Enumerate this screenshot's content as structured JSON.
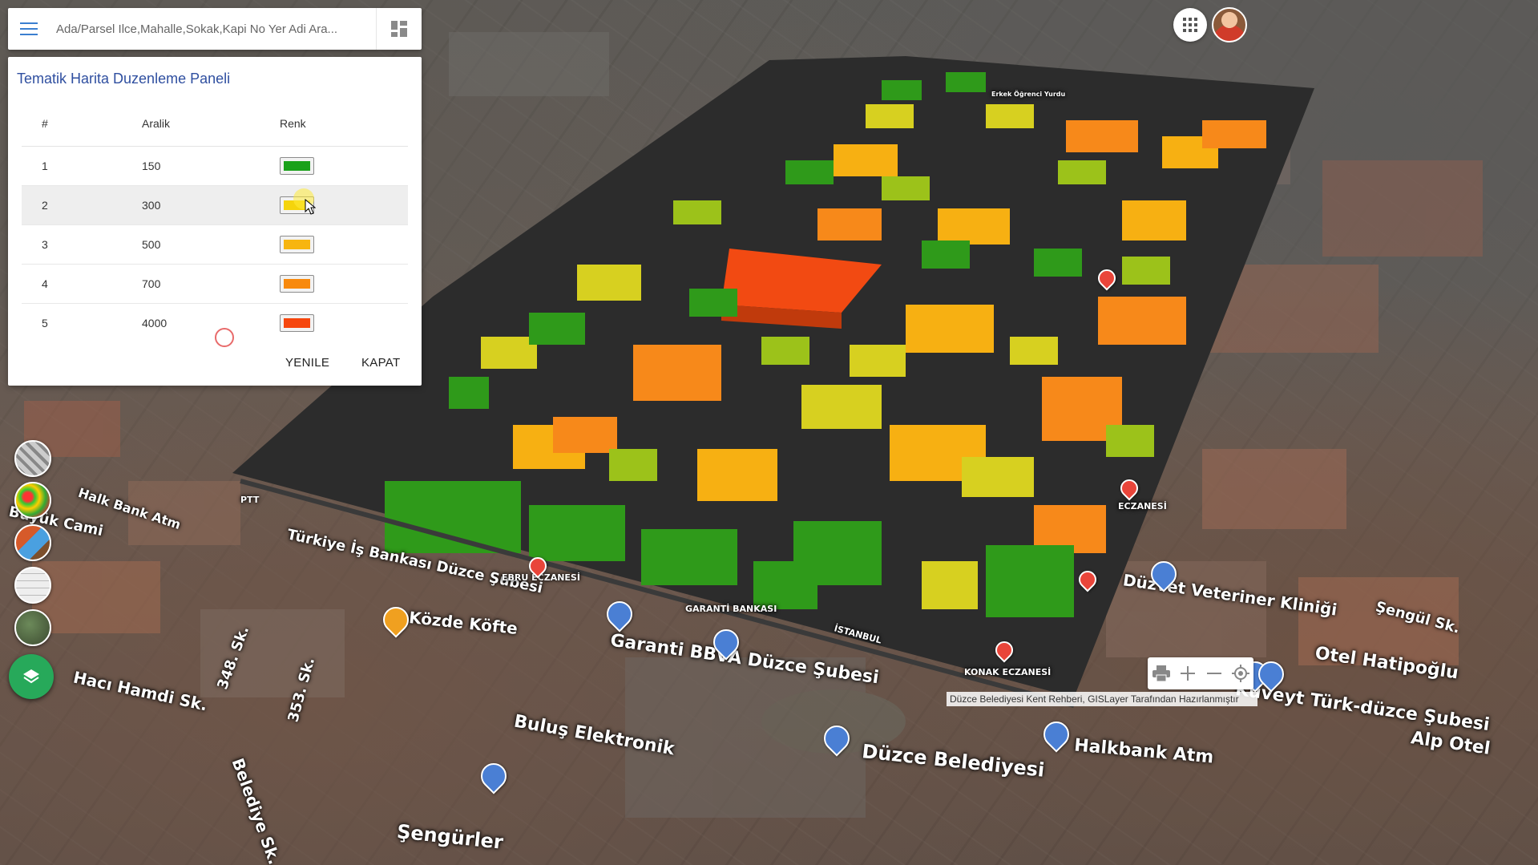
{
  "search": {
    "placeholder": "Ada/Parsel Ilce,Mahalle,Sokak,Kapi No Yer Adi Ara..."
  },
  "panel": {
    "title": "Tematik Harita Duzenleme Paneli",
    "headers": {
      "index": "#",
      "range": "Aralik",
      "color": "Renk"
    },
    "rows": [
      {
        "index": "1",
        "range": "150",
        "color": "#1aa11a"
      },
      {
        "index": "2",
        "range": "300",
        "color": "#f5d40c"
      },
      {
        "index": "3",
        "range": "500",
        "color": "#f7b50f"
      },
      {
        "index": "4",
        "range": "700",
        "color": "#f8890d"
      },
      {
        "index": "5",
        "range": "4000",
        "color": "#f6460d"
      }
    ],
    "refresh_label": "YENILE",
    "close_label": "KAPAT"
  },
  "map": {
    "labels": [
      "Garanti BBVA Düzce Şubesi",
      "Düzce Belediyesi",
      "Buluş Elektronik",
      "Halkbank Atm",
      "Kuveyt Türk-düzce Şubesi",
      "Alp Otel",
      "Otel Hatipoğlu",
      "Düzvet Veteriner Kliniği",
      "Şengül Sk.",
      "Közde Köfte",
      "Türkiye İş Bankası Düzce Şubesi",
      "Hacı Hamdi Sk.",
      "Şengürler",
      "Belediye Sk.",
      "353. Sk.",
      "348. Sk.",
      "Halk Bank Atm",
      "Büyük Cami"
    ],
    "small_labels": [
      "EBRU ECZANESİ",
      "GARANTİ BANKASI",
      "KONAK ECZANESİ",
      "İSTANBUL",
      "PTT",
      "ECZANESİ",
      "Erkek Öğrenci Yurdu"
    ]
  },
  "layers": [
    {
      "name": "3d-buildings-layer"
    },
    {
      "name": "heatmap-layer"
    },
    {
      "name": "parcel-layer"
    },
    {
      "name": "street-map-layer"
    },
    {
      "name": "satellite-layer"
    }
  ],
  "attribution": "Düzce Belediyesi Kent Rehberi, GISLayer Tarafından Hazırlanmıştır",
  "icons": {
    "menu": "menu-icon",
    "grid": "dashboard-icon",
    "apps": "apps-icon",
    "layers": "layers-icon",
    "print": "print-icon",
    "zoom_in": "plus-icon",
    "zoom_out": "minus-icon",
    "locate": "locate-icon"
  }
}
